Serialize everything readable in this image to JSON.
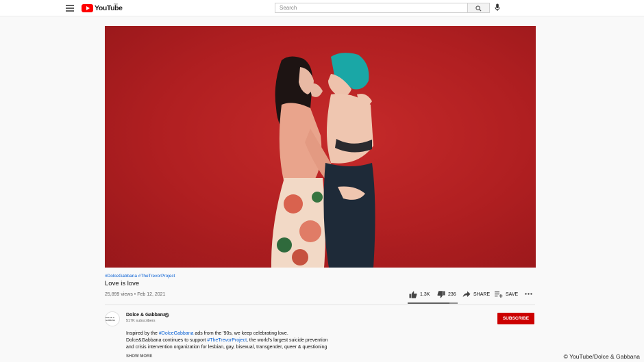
{
  "header": {
    "logo_text": "YouTube",
    "logo_country": "DE",
    "search_placeholder": "Search"
  },
  "video": {
    "hashtags": "#DolceGabbana #TheTrevorProject",
    "title": "Love is love",
    "views_date": "25,899 views • Feb 12, 2021",
    "likes": "1.3K",
    "dislikes": "236",
    "share_label": "SHARE",
    "save_label": "SAVE",
    "like_ratio": 0.84
  },
  "channel": {
    "avatar_text": "DOLCE & GABBANA",
    "name": "Dolce & Gabbana",
    "subscribers": "517K subscribers",
    "subscribe_label": "SUBSCRIBE"
  },
  "description": {
    "line1_a": "Inspired by the ",
    "line1_link": "#DolceGabbana",
    "line1_b": " ads from the '90s, we keep celebrating love.",
    "line2_a": "Dolce&Gabbana continues to support ",
    "line2_link": "#TheTrevorProject",
    "line2_b": ", the world's largest suicide prevention",
    "line3": "and crisis intervention organization for lesbian, gay, bisexual, transgender, queer & questioning",
    "show_more": "SHOW MORE"
  },
  "credit": "© YouTube/Dolce & Gabbana",
  "colors": {
    "subscribe": "#cc0000",
    "link": "#065fd4",
    "video_background": "#b01f21"
  }
}
